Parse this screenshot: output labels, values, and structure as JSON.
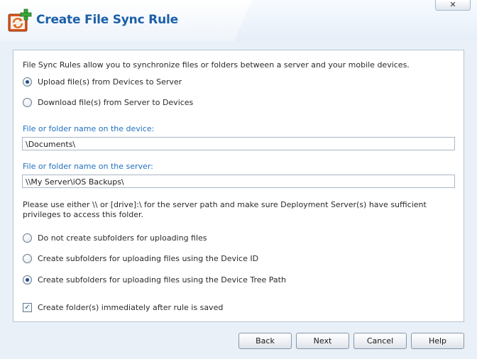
{
  "window": {
    "title": "Create File Sync Rule",
    "close_label": "✕"
  },
  "description": "File Sync Rules allow you to synchronize files or folders between a server and your mobile devices.",
  "direction": {
    "options": [
      {
        "label": "Upload file(s) from Devices to Server",
        "selected": true
      },
      {
        "label": "Download file(s) from Server to Devices",
        "selected": false
      }
    ]
  },
  "device_path": {
    "label": "File or folder name on the device:",
    "value": "\\Documents\\"
  },
  "server_path": {
    "label": "File or folder name on the server:",
    "value": "\\\\My Server\\iOS Backups\\"
  },
  "note": "Please use either \\\\ or [drive]:\\ for the server path and make sure Deployment Server(s) have sufficient privileges to access this folder.",
  "subfolders": {
    "options": [
      {
        "label": "Do not create subfolders for uploading files",
        "selected": false
      },
      {
        "label": "Create subfolders for uploading files using the Device ID",
        "selected": false
      },
      {
        "label": "Create subfolders for uploading files using the Device Tree Path",
        "selected": true
      }
    ]
  },
  "create_immediately": {
    "label": "Create folder(s) immediately after rule is saved",
    "checked": true,
    "check_glyph": "✓"
  },
  "buttons": {
    "back": "Back",
    "next": "Next",
    "cancel": "Cancel",
    "help": "Help"
  }
}
